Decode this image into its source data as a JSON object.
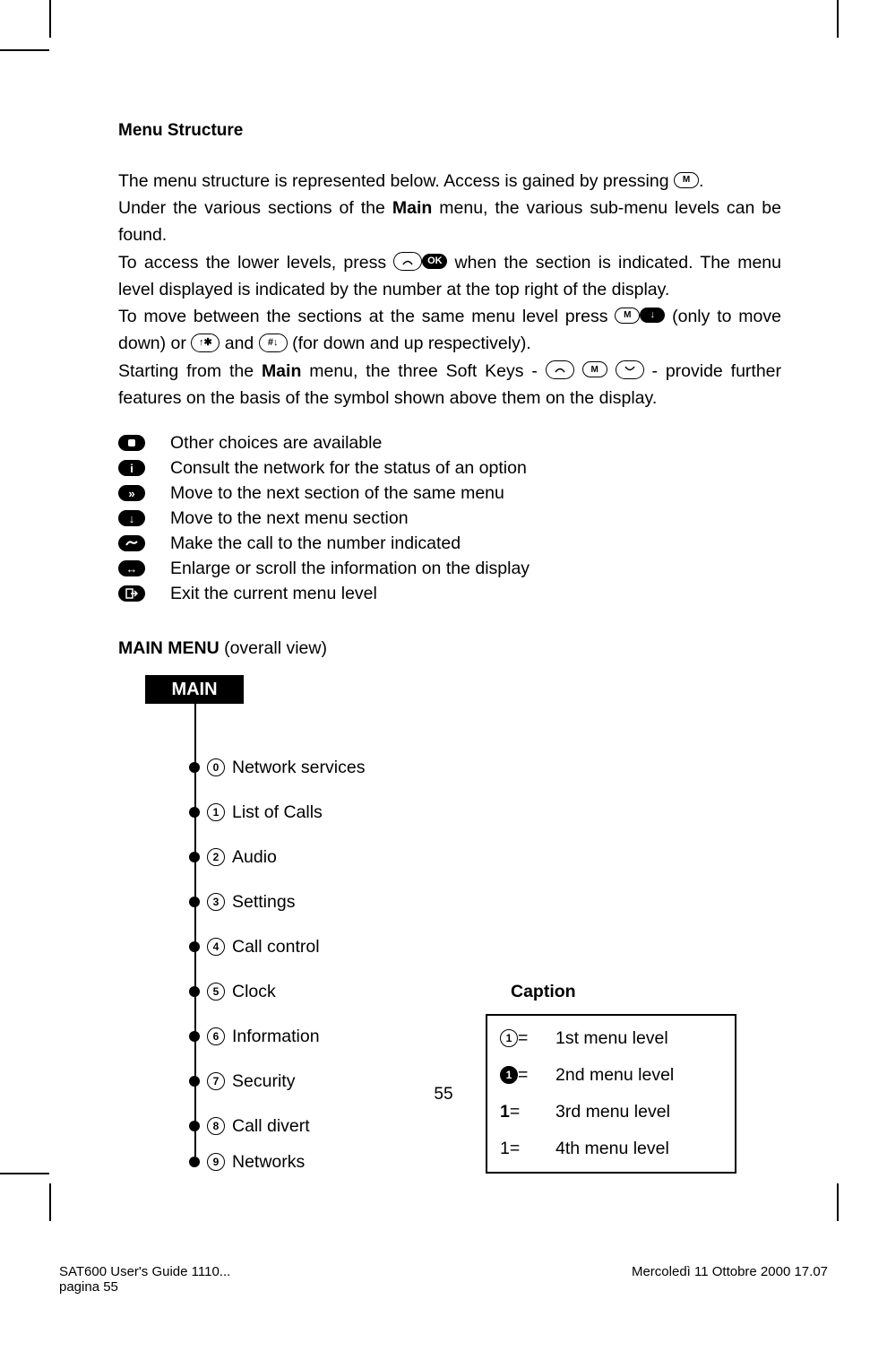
{
  "title": "Menu Structure",
  "para": {
    "p1a": "The menu structure is represented below.  Access is gained by pressing ",
    "p1b": ".",
    "p2a": "Under the various sections of the ",
    "p2b": "Main",
    "p2c": " menu, the various sub-menu levels can be found.",
    "p3a": "To access the lower levels, press ",
    "p3b": " when the section is indicated. The menu level displayed is indicated by the number at the top right of the display.",
    "p4a": "To move between the sections at the same menu level press ",
    "p4b": " (only to move down) or ",
    "p4c": " and ",
    "p4d": " (for down and up respectively).",
    "p5a": "Starting from the ",
    "p5b": "Main",
    "p5c": " menu, the three Soft Keys - ",
    "p5d": " - provide further features on the basis of the symbol shown above them on the display."
  },
  "legend": [
    {
      "icon": "square-open",
      "text": "Other choices are available"
    },
    {
      "icon": "info",
      "text": "Consult the network for the status of an option"
    },
    {
      "icon": "next",
      "text": "Move to the next section of the same menu"
    },
    {
      "icon": "down",
      "text": "Move to the next menu section"
    },
    {
      "icon": "call",
      "text": "Make the call to the number indicated"
    },
    {
      "icon": "scroll",
      "text": "Enlarge or scroll the information on the display"
    },
    {
      "icon": "exit",
      "text": "Exit the current menu level"
    }
  ],
  "mainmenu_title_a": "MAIN MENU",
  "mainmenu_title_b": " (overall view)",
  "mainbox": "MAIN",
  "menu_items": [
    {
      "num": "0",
      "label": "Network services"
    },
    {
      "num": "1",
      "label": "List of Calls"
    },
    {
      "num": "2",
      "label": "Audio"
    },
    {
      "num": "3",
      "label": "Settings"
    },
    {
      "num": "4",
      "label": "Call control"
    },
    {
      "num": "5",
      "label": "Clock"
    },
    {
      "num": "6",
      "label": "Information"
    },
    {
      "num": "7",
      "label": "Security"
    },
    {
      "num": "8",
      "label": "Call divert"
    },
    {
      "num": "9",
      "label": "Networks"
    }
  ],
  "caption_title": "Caption",
  "caption_rows": [
    {
      "sym": "circ-open",
      "symtext": "1",
      "eq": " =",
      "desc": "1st menu level"
    },
    {
      "sym": "circ-solid",
      "symtext": "1",
      "eq": " =",
      "desc": "2nd menu level"
    },
    {
      "sym": "bold",
      "symtext": "1",
      "eq": " =",
      "desc": "3rd menu level"
    },
    {
      "sym": "plain",
      "symtext": "1",
      "eq": " =",
      "desc": "4th menu level"
    }
  ],
  "pagenum": "55",
  "footer": {
    "l1": "SAT600 User's Guide 1110...",
    "l2": "pagina 55",
    "r": "Mercoledì 11 Ottobre 2000 17.07"
  },
  "inline_keys": {
    "ok": "OK",
    "m": "M",
    "star": "↑✱",
    "hash": "#↓",
    "down": "↓"
  }
}
